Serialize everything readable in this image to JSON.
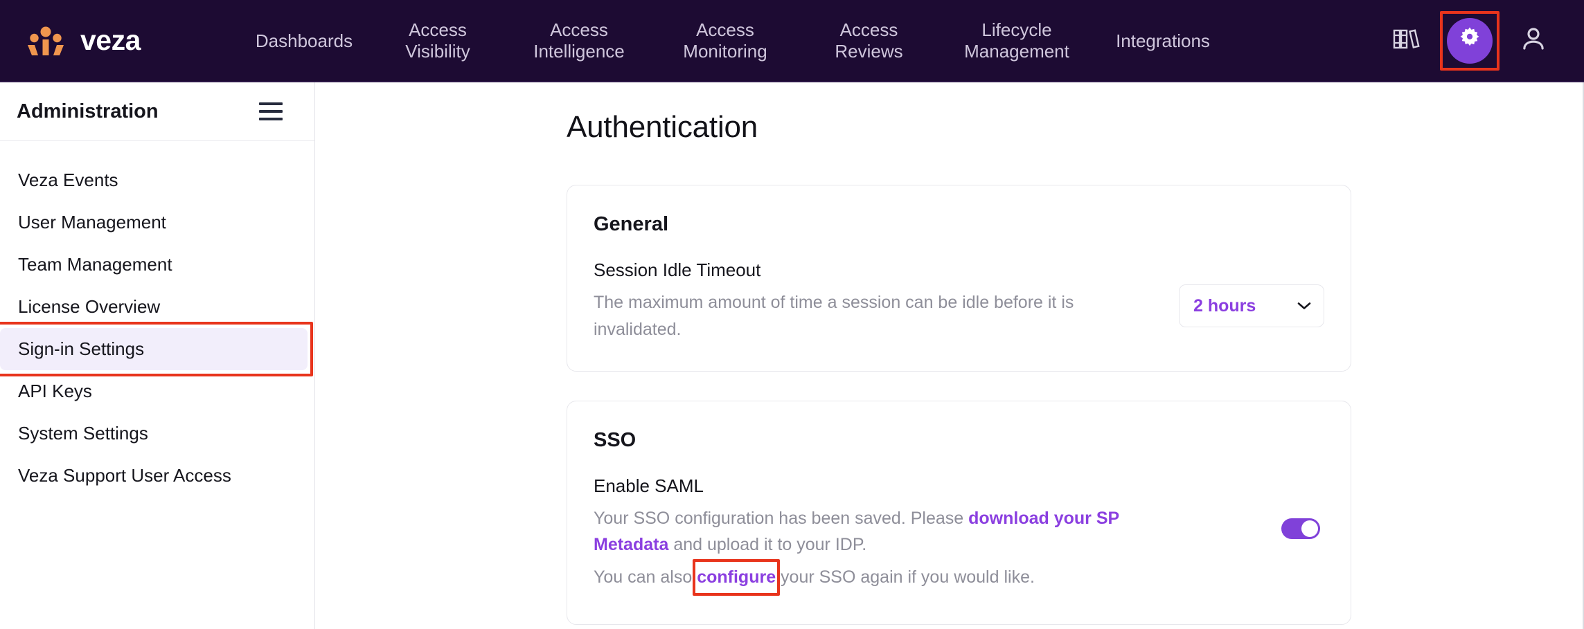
{
  "brand": {
    "name": "veza",
    "logo_icon": "veza-logo-icon"
  },
  "topnav": {
    "items": [
      {
        "label": "Dashboards",
        "lines": [
          "Dashboards"
        ]
      },
      {
        "label": "Access Visibility",
        "lines": [
          "Access",
          "Visibility"
        ]
      },
      {
        "label": "Access Intelligence",
        "lines": [
          "Access",
          "Intelligence"
        ]
      },
      {
        "label": "Access Monitoring",
        "lines": [
          "Access",
          "Monitoring"
        ]
      },
      {
        "label": "Access Reviews",
        "lines": [
          "Access",
          "Reviews"
        ]
      },
      {
        "label": "Lifecycle Management",
        "lines": [
          "Lifecycle",
          "Management"
        ]
      },
      {
        "label": "Integrations",
        "lines": [
          "Integrations"
        ]
      }
    ],
    "labels": {
      "dashboards": "Dashboards",
      "access_visibility": "Access\nVisibility",
      "access_intelligence": "Access\nIntelligence",
      "access_monitoring": "Access\nMonitoring",
      "access_reviews": "Access\nReviews",
      "lifecycle_management": "Lifecycle\nManagement",
      "integrations": "Integrations"
    },
    "icons": {
      "library": "library-books-icon",
      "settings": "gear-icon",
      "account": "user-account-icon"
    },
    "background": "#1d0b33",
    "text_color": "#cfc6dc",
    "settings_active_bg": "#8041d9"
  },
  "sidebar": {
    "title": "Administration",
    "menu_icon": "hamburger-menu-icon",
    "items": [
      {
        "label": "Veza Events",
        "active": false
      },
      {
        "label": "User Management",
        "active": false
      },
      {
        "label": "Team Management",
        "active": false
      },
      {
        "label": "License Overview",
        "active": false
      },
      {
        "label": "Sign-in Settings",
        "active": true
      },
      {
        "label": "API Keys",
        "active": false
      },
      {
        "label": "System Settings",
        "active": false
      },
      {
        "label": "Veza Support User Access",
        "active": false
      }
    ],
    "active_bg": "#f2eefb"
  },
  "main": {
    "page_title": "Authentication",
    "general": {
      "title": "General",
      "session_idle_timeout": {
        "label": "Session Idle Timeout",
        "description": "The maximum amount of time a session can be idle before it is invalidated.",
        "select_value": "2 hours",
        "select_icon": "chevron-down-icon"
      }
    },
    "sso": {
      "title": "SSO",
      "enable_saml": {
        "label": "Enable SAML",
        "desc_part1": "Your SSO configuration has been saved. Please ",
        "metadata_link": "download your SP Metadata",
        "desc_part2": " and upload it to your IDP.",
        "desc_line2_part1": "You can also ",
        "configure_link": "configure",
        "desc_line2_part2": " your SSO again if you would like.",
        "toggle_on": true
      }
    }
  },
  "annotations": {
    "color": "#e8341c",
    "targets": [
      "settings-gear-icon",
      "sidebar-item-sign-in-settings",
      "configure-link"
    ]
  }
}
